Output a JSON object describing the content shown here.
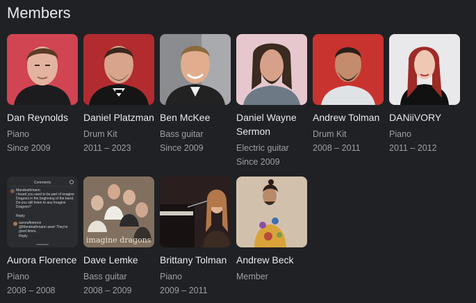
{
  "section": {
    "title": "Members"
  },
  "members": [
    {
      "name": "Dan Reynolds",
      "role": "Piano",
      "years": "Since 2009",
      "photo_bg": "#c63a47"
    },
    {
      "name": "Daniel Platzman",
      "role": "Drum Kit",
      "years": "2011 – 2023",
      "photo_bg": "#b12b2f"
    },
    {
      "name": "Ben McKee",
      "role": "Bass guitar",
      "years": "Since 2009",
      "photo_bg": "#8a8c90"
    },
    {
      "name": "Daniel Wayne Sermon",
      "role": "Electric guitar",
      "years": "Since 2009",
      "photo_bg": "#e6c7cd"
    },
    {
      "name": "Andrew Tolman",
      "role": "Drum Kit",
      "years": "2008 – 2011",
      "photo_bg": "#c9332f"
    },
    {
      "name": "DANiiVORY",
      "role": "Piano",
      "years": "2011 – 2012",
      "photo_bg": "#e9e9ec"
    },
    {
      "name": "Aurora Florence",
      "role": "Piano",
      "years": "2008 – 2008",
      "photo_bg": "#2b2c2f"
    },
    {
      "name": "Dave Lemke",
      "role": "Bass guitar",
      "years": "2008 – 2009",
      "photo_bg": "#6b5a4d"
    },
    {
      "name": "Brittany Tolman",
      "role": "Piano",
      "years": "2009 – 2011",
      "photo_bg": "#2a1e1e"
    },
    {
      "name": "Andrew Beck",
      "role": "Member",
      "years": "",
      "photo_bg": "#c8b6a0"
    }
  ],
  "aurora_photo_text": {
    "header": "Comments",
    "c1_user": "Mandeathmann",
    "c1_line1": "i heard you used to be part of imagine",
    "c1_line2": "Dragons in the beginning of the band.",
    "c1_line3": "Do you still listen to any Imagine",
    "c1_line4": "Dragons?",
    "c1_reply": "Reply",
    "c2_user": "auroraflorence",
    "c2_line1": "@Mandeathmann aww! They're",
    "c2_line2": "good times.",
    "c2_reply": "Reply"
  },
  "lemke_photo_text": "imagine dragons"
}
